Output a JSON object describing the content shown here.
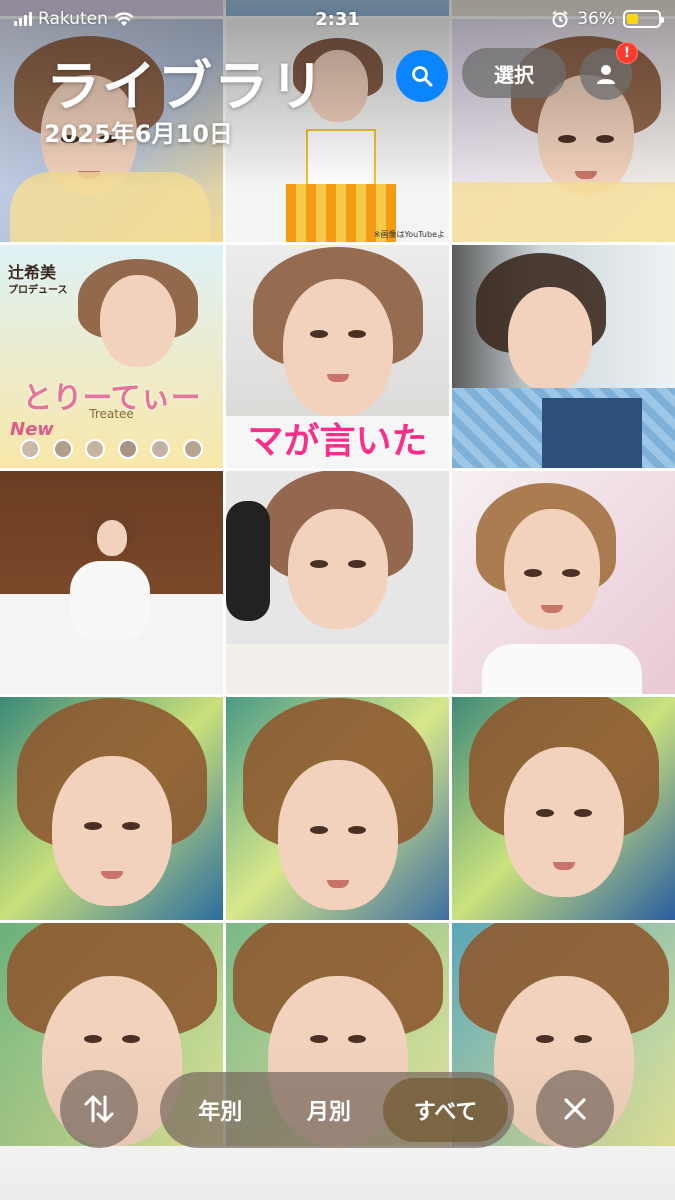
{
  "status_bar": {
    "carrier": "Rakuten",
    "time": "2:31",
    "battery_percent": "36%",
    "battery_level": 0.36,
    "icons": [
      "signal-icon",
      "wifi-icon",
      "alarm-icon",
      "battery-icon"
    ]
  },
  "header": {
    "title": "ライブラリ",
    "date": "2025年6月10日",
    "search_icon": "search-icon",
    "select_label": "選択",
    "account_icon": "person-icon",
    "account_badge": "!"
  },
  "tiles": [
    {
      "caption": ""
    },
    {
      "caption": ""
    },
    {
      "caption": ""
    },
    {
      "caption": "※画像はYouTubeよ"
    },
    {
      "caption": ""
    },
    {
      "caption": ""
    },
    {
      "caption_main": "とりーてぃー",
      "caption_sub": "Treatee",
      "caption_top": "辻希美",
      "caption_top2": "プロデュース",
      "caption_new": "New"
    },
    {
      "caption_banner": "マが言いた"
    },
    {
      "caption": ""
    },
    {
      "caption": ""
    },
    {
      "caption": ""
    },
    {
      "caption": ""
    },
    {
      "caption": ""
    },
    {
      "caption": ""
    },
    {
      "caption": ""
    },
    {
      "caption": ""
    },
    {
      "caption": ""
    },
    {
      "caption": ""
    }
  ],
  "bottom_bar": {
    "sort_icon": "sort-arrows-icon",
    "segments": [
      "年別",
      "月別",
      "すべて"
    ],
    "active_segment": "すべて",
    "close_icon": "close-icon"
  },
  "colors": {
    "accent": "#0a84ff",
    "badge": "#ff3b30",
    "battery_fill": "#ffd60a"
  }
}
